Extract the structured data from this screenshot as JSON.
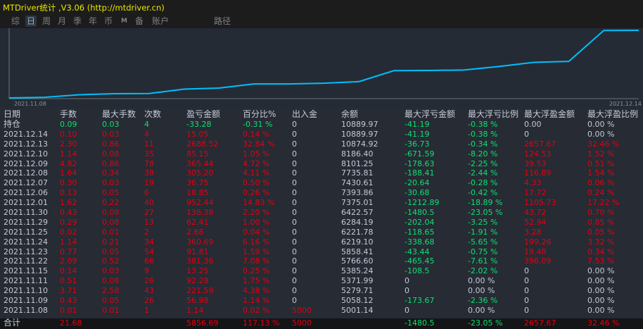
{
  "app": {
    "title": "MTDriver统计 ,V3.06 (http://mtdriver.cn)"
  },
  "toolbar": {
    "items": [
      "综",
      "日",
      "周",
      "月",
      "季",
      "年",
      "币",
      "M",
      "备",
      "账户",
      "路径"
    ],
    "active": "日"
  },
  "chart_data": {
    "type": "line",
    "title": "",
    "x_start_label": "2021.11.08",
    "x_end_label": "2021.12.14",
    "x": [
      "2021.11.08",
      "2021.11.09",
      "2021.11.10",
      "2021.11.11",
      "2021.11.15",
      "2021.11.22",
      "2021.11.23",
      "2021.11.24",
      "2021.11.25",
      "2021.11.29",
      "2021.11.30",
      "2021.12.01",
      "2021.12.06",
      "2021.12.07",
      "2021.12.08",
      "2021.12.09",
      "2021.12.10",
      "2021.12.13",
      "2021.12.14"
    ],
    "series": [
      {
        "name": "余额",
        "values": [
          5001.14,
          5058.12,
          5279.71,
          5371.99,
          5385.24,
          5766.6,
          5858.41,
          6219.1,
          6221.78,
          6284.19,
          6422.57,
          7375.01,
          7393.86,
          7430.61,
          7735.81,
          8101.25,
          8186.4,
          10874.92,
          10889.97
        ]
      }
    ],
    "ylim": [
      5001.14,
      10889.97
    ],
    "color": "#00bfff"
  },
  "table": {
    "headers": [
      "日期",
      "手数",
      "最大手数",
      "次数",
      "盈亏金额",
      "百分比%",
      "出入金",
      "余额",
      "最大浮亏金额",
      "最大浮亏比例",
      "最大浮盈金额",
      "最大浮盈比例"
    ],
    "position_row": [
      "持仓",
      "0.09",
      "0.03",
      "4",
      "-33.28",
      "-0.31 %",
      "0",
      "10889.97",
      "-41.19",
      "-0.38 %",
      "0.00",
      "0.00 %"
    ],
    "rows": [
      [
        "2021.12.14",
        "0.10",
        "0.03",
        "4",
        "15.05",
        "0.14 %",
        "0",
        "10889.97",
        "-41.19",
        "-0.38 %",
        "0",
        "0.00 %"
      ],
      [
        "2021.12.13",
        "2.30",
        "0.86",
        "11",
        "2688.52",
        "32.84 %",
        "0",
        "10874.92",
        "-36.73",
        "-0.34 %",
        "2657.67",
        "32.46 %"
      ],
      [
        "2021.12.10",
        "1.14",
        "0.08",
        "35",
        "85.15",
        "1.05 %",
        "0",
        "8186.40",
        "-671.59",
        "-8.20 %",
        "124.53",
        "1.52 %"
      ],
      [
        "2021.12.09",
        "4.82",
        "0.86",
        "78",
        "365.44",
        "4.72 %",
        "0",
        "8101.25",
        "-178.63",
        "-2.25 %",
        "39.53",
        "0.51 %"
      ],
      [
        "2021.12.08",
        "1.64",
        "0.34",
        "39",
        "305.20",
        "4.11 %",
        "0",
        "7735.81",
        "-188.41",
        "-2.44 %",
        "116.89",
        "1.54 %"
      ],
      [
        "2021.12.07",
        "0.30",
        "0.03",
        "19",
        "36.75",
        "0.50 %",
        "0",
        "7430.61",
        "-20.64",
        "-0.28 %",
        "4.33",
        "0.06 %"
      ],
      [
        "2021.12.06",
        "0.13",
        "0.05",
        "6",
        "18.85",
        "0.26 %",
        "0",
        "7393.86",
        "-30.68",
        "-0.42 %",
        "17.72",
        "0.24 %"
      ],
      [
        "2021.12.01",
        "1.62",
        "0.22",
        "40",
        "952.44",
        "14.83 %",
        "0",
        "7375.01",
        "-1212.89",
        "-18.89 %",
        "1105.73",
        "17.22 %"
      ],
      [
        "2021.11.30",
        "0.43",
        "0.08",
        "27",
        "138.38",
        "2.20 %",
        "0",
        "6422.57",
        "-1480.5",
        "-23.05 %",
        "43.72",
        "0.70 %"
      ],
      [
        "2021.11.29",
        "0.29",
        "0.08",
        "13",
        "62.41",
        "1.00 %",
        "0",
        "6284.19",
        "-202.04",
        "-3.25 %",
        "52.94",
        "0.85 %"
      ],
      [
        "2021.11.25",
        "0.02",
        "0.01",
        "2",
        "2.68",
        "0.04 %",
        "0",
        "6221.78",
        "-118.65",
        "-1.91 %",
        "3.28",
        "0.05 %"
      ],
      [
        "2021.11.24",
        "1.14",
        "0.21",
        "34",
        "360.69",
        "6.16 %",
        "0",
        "6219.10",
        "-338.68",
        "-5.65 %",
        "199.26",
        "3.32 %"
      ],
      [
        "2021.11.23",
        "0.77",
        "0.05",
        "54",
        "91.81",
        "1.59 %",
        "0",
        "5858.41",
        "-43.44",
        "-0.75 %",
        "19.48",
        "0.34 %"
      ],
      [
        "2021.11.22",
        "2.09",
        "0.52",
        "66",
        "381.36",
        "7.08 %",
        "0",
        "5766.60",
        "-465.45",
        "-7.61 %",
        "396.09",
        "7.53 %"
      ],
      [
        "2021.11.15",
        "0.14",
        "0.03",
        "9",
        "13.25",
        "0.25 %",
        "0",
        "5385.24",
        "-108.5",
        "-2.02 %",
        "0",
        "0.00 %"
      ],
      [
        "2021.11.11",
        "0.51",
        "0.08",
        "26",
        "92.28",
        "1.75 %",
        "0",
        "5371.99",
        "0",
        "0.00 %",
        "0",
        "0.00 %"
      ],
      [
        "2021.11.10",
        "3.71",
        "2.58",
        "43",
        "221.59",
        "4.38 %",
        "0",
        "5279.71",
        "0",
        "0.00 %",
        "0",
        "0.00 %"
      ],
      [
        "2021.11.09",
        "0.43",
        "0.05",
        "26",
        "56.98",
        "1.14 %",
        "0",
        "5058.12",
        "-173.67",
        "-2.36 %",
        "0",
        "0.00 %"
      ],
      [
        "2021.11.08",
        "0.01",
        "0.01",
        "1",
        "1.14",
        "0.02 %",
        "5000",
        "5001.14",
        "0",
        "0.00 %",
        "0",
        "0.00 %"
      ]
    ],
    "total_row": [
      "合计",
      "21.68",
      "",
      "",
      "5856.69",
      "117.13 %",
      "5000",
      "",
      "-1480.5",
      "-23.05 %",
      "2657.67",
      "32.46 %"
    ]
  }
}
